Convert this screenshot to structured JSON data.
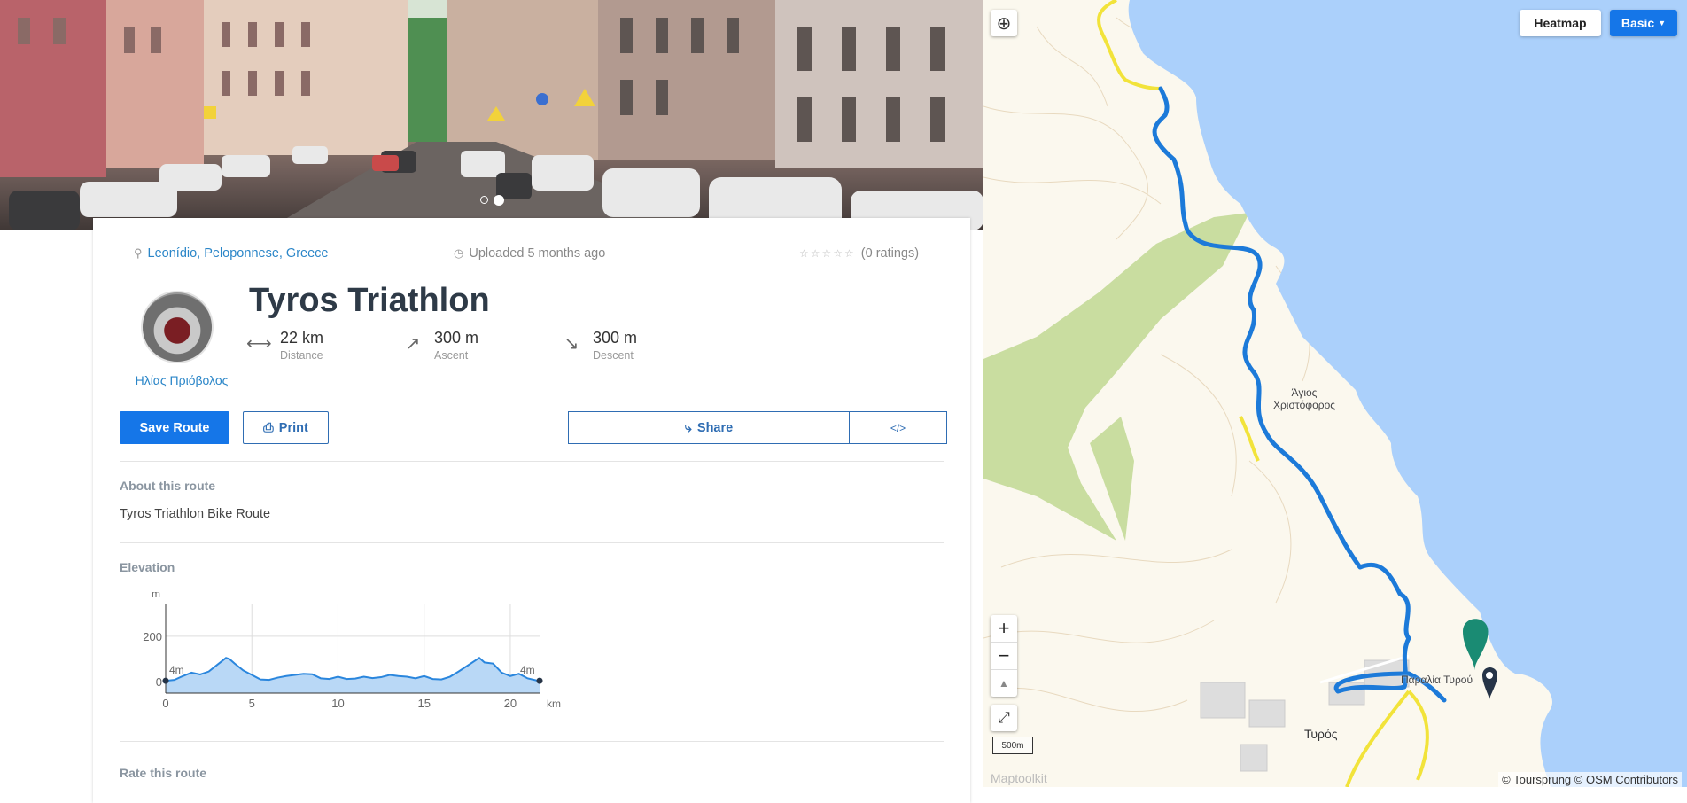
{
  "hero": {
    "slides": 2,
    "active_slide": 2
  },
  "route": {
    "location": "Leonídio, Peloponnese, Greece",
    "uploaded": "Uploaded 5 months ago",
    "ratings": "(0 ratings)",
    "rating_value": 0,
    "rating_max": 5,
    "title": "Tyros Triathlon",
    "author": "Ηλίας Πριόβολος",
    "stats": [
      {
        "value": "22 km",
        "label": "Distance",
        "icon": "distance-icon"
      },
      {
        "value": "300 m",
        "label": "Ascent",
        "icon": "ascent-icon"
      },
      {
        "value": "300 m",
        "label": "Descent",
        "icon": "descent-icon"
      }
    ]
  },
  "actions": {
    "save": "Save Route",
    "print": "Print",
    "share": "Share",
    "embed": "</>"
  },
  "about": {
    "heading": "About this route",
    "text": "Tyros Triathlon Bike Route"
  },
  "elevation": {
    "heading": "Elevation"
  },
  "rate": {
    "heading": "Rate this route"
  },
  "chart_data": {
    "type": "area",
    "title": "",
    "xlabel": "km",
    "ylabel": "m",
    "xlim": [
      0,
      21.7
    ],
    "ylim": [
      -50,
      340
    ],
    "xticks": [
      0,
      5,
      10,
      15,
      20
    ],
    "yticks": [
      0,
      200
    ],
    "start_label": "4m",
    "end_label": "4m",
    "series": [
      {
        "x": [
          0,
          0.5,
          1,
          1.5,
          2,
          2.5,
          3,
          3.5,
          3.7,
          4,
          4.5,
          5,
          5.5,
          6,
          6.5,
          7,
          7.5,
          8,
          8.5,
          9,
          9.5,
          10,
          10.5,
          11,
          11.5,
          12,
          12.5,
          13,
          13.5,
          14,
          14.5,
          15,
          15.5,
          16,
          16.5,
          17,
          17.5,
          18,
          18.2,
          18.5,
          19,
          19.5,
          20,
          20.5,
          21,
          21.5,
          21.7
        ],
        "y": [
          4,
          8,
          25,
          40,
          32,
          45,
          75,
          105,
          100,
          80,
          50,
          30,
          10,
          8,
          18,
          25,
          30,
          35,
          33,
          15,
          12,
          22,
          12,
          14,
          22,
          16,
          20,
          30,
          25,
          22,
          15,
          25,
          12,
          10,
          22,
          45,
          70,
          95,
          105,
          85,
          80,
          40,
          25,
          35,
          15,
          6,
          4
        ]
      }
    ]
  },
  "map": {
    "heatmap": "Heatmap",
    "basic": "Basic",
    "town": "Τυρός",
    "chapel": "Άγιος Χριστόφορος",
    "beach": "Παραλία Τυρού",
    "scale": "500m",
    "attribution": "© Toursprung © OSM Contributors",
    "brand": "Maptoolkit",
    "colors": {
      "route": "#1c7ad9",
      "road": "#f2e33a",
      "sea": "#abd0fb",
      "forest": "#c9dda0"
    }
  }
}
